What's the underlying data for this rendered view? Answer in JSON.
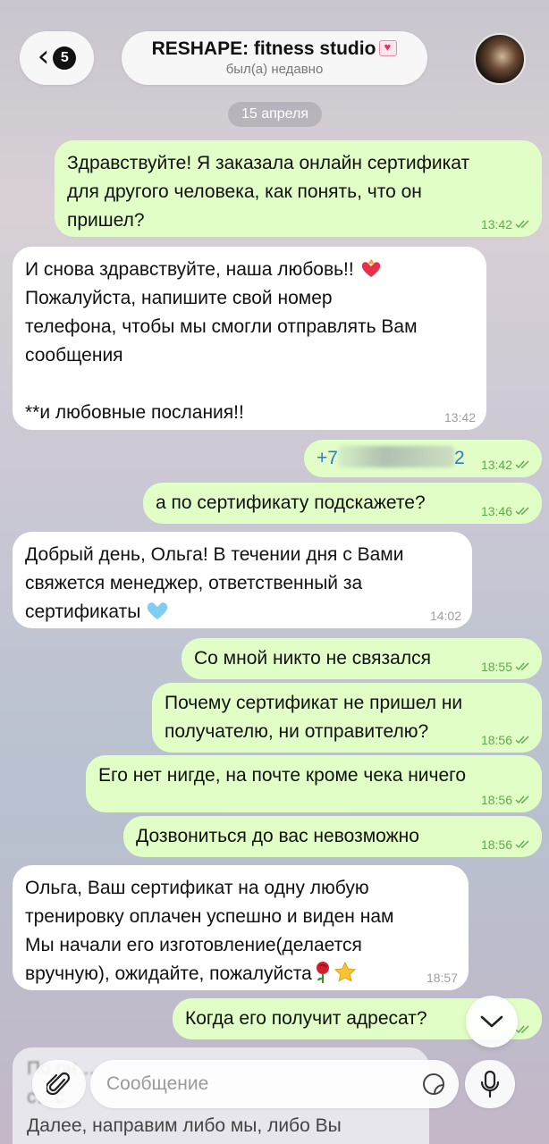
{
  "header": {
    "back_count": "5",
    "title": "RESHAPE: fitness studio",
    "status": "был(а) недавно"
  },
  "date_divider": "15 апреля",
  "messages": [
    {
      "dir": "out",
      "text": "Здравствуйте! Я заказала онлайн сертификат\nдля другого человека, как понять, что он\nпришел?",
      "time": "13:42",
      "read": true
    },
    {
      "dir": "in",
      "text": "И снова здравствуйте, наша любовь!! ",
      "text2": "Пожалуйста, напишите свой номер\nтелефона, чтобы мы смогли отправлять Вам\nсообщения\n\n**и любовные послания!!",
      "time": "13:42"
    },
    {
      "dir": "out",
      "text_prefix": "+7",
      "text_suffix": "2",
      "time": "13:42",
      "read": true
    },
    {
      "dir": "out",
      "text": "а по сертификату подскажете?",
      "time": "13:46",
      "read": true
    },
    {
      "dir": "in",
      "text": "Добрый день, Ольга! В течении дня с Вами\nсвяжется менеджер, ответственный за\nсертификаты ",
      "time": "14:02"
    },
    {
      "dir": "out",
      "text": "Со мной никто не связался",
      "time": "18:55",
      "read": true
    },
    {
      "dir": "out",
      "text": "Почему сертификат не пришел ни\nполучателю, ни отправителю?",
      "time": "18:56",
      "read": true
    },
    {
      "dir": "out",
      "text": "Его нет нигде, на почте кроме чека ничего",
      "time": "18:56",
      "read": true
    },
    {
      "dir": "out",
      "text": "Дозвониться до вас невозможно",
      "time": "18:56",
      "read": true
    },
    {
      "dir": "in",
      "text": "Ольга, Ваш сертификат на одну любую\nтренировку оплачен успешно и виден нам\nМы начали его изготовление(делается\nвручную), ожидайте, пожалуйста",
      "time": "18:57"
    },
    {
      "dir": "out",
      "text": "Когда его получит адресат?",
      "time": "",
      "read": true
    }
  ],
  "preview": {
    "line1": "По он…",
    "line2": "с…с",
    "line3": "Далее, направим либо мы, либо Вы"
  },
  "input": {
    "placeholder": "Сообщение"
  },
  "colors": {
    "outgoing_bubble": "#e1fec6",
    "incoming_bubble": "#ffffff",
    "check_green": "#5faa4d",
    "link_blue": "#2a7bd1"
  }
}
